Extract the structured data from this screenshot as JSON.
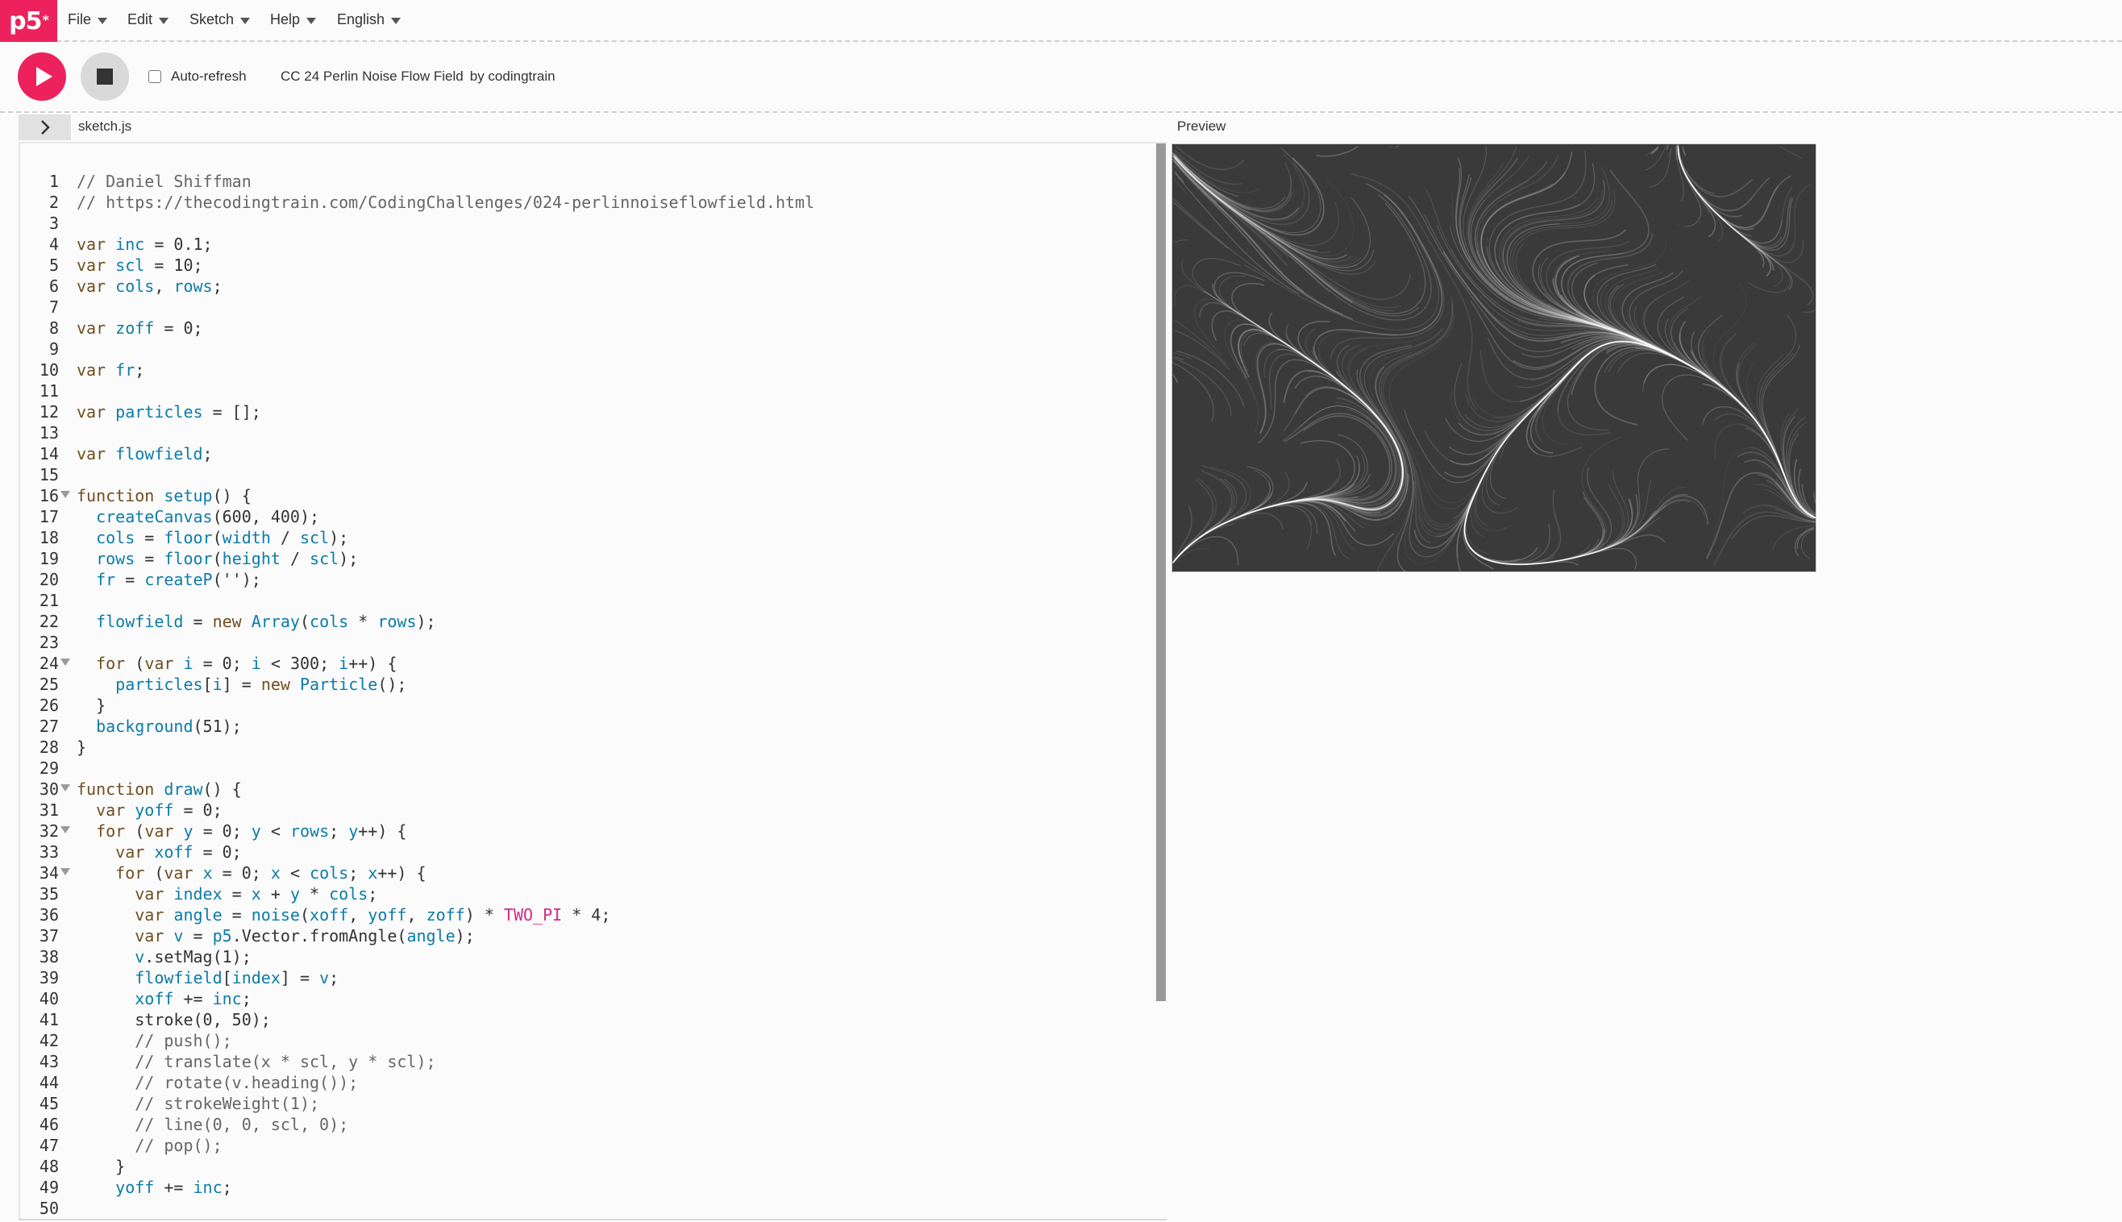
{
  "menubar": {
    "logo": "p5",
    "items": [
      {
        "label": "File"
      },
      {
        "label": "Edit"
      },
      {
        "label": "Sketch"
      },
      {
        "label": "Help"
      },
      {
        "label": "English"
      }
    ]
  },
  "toolbar": {
    "auto_refresh_label": "Auto-refresh",
    "auto_refresh_checked": false,
    "sketch_name": "CC 24 Perlin Noise Flow Field",
    "author": "by codingtrain"
  },
  "editor": {
    "file_name": "sketch.js",
    "folded_lines": [
      16,
      24,
      30,
      32,
      34
    ],
    "lines": [
      "// Daniel Shiffman",
      "// https://thecodingtrain.com/CodingChallenges/024-perlinnoiseflowfield.html",
      "",
      "var inc = 0.1;",
      "var scl = 10;",
      "var cols, rows;",
      "",
      "var zoff = 0;",
      "",
      "var fr;",
      "",
      "var particles = [];",
      "",
      "var flowfield;",
      "",
      "function setup() {",
      "  createCanvas(600, 400);",
      "  cols = floor(width / scl);",
      "  rows = floor(height / scl);",
      "  fr = createP('');",
      "",
      "  flowfield = new Array(cols * rows);",
      "",
      "  for (var i = 0; i < 300; i++) {",
      "    particles[i] = new Particle();",
      "  }",
      "  background(51);",
      "}",
      "",
      "function draw() {",
      "  var yoff = 0;",
      "  for (var y = 0; y < rows; y++) {",
      "    var xoff = 0;",
      "    for (var x = 0; x < cols; x++) {",
      "      var index = x + y * cols;",
      "      var angle = noise(xoff, yoff, zoff) * TWO_PI * 4;",
      "      var v = p5.Vector.fromAngle(angle);",
      "      v.setMag(1);",
      "      flowfield[index] = v;",
      "      xoff += inc;",
      "      stroke(0, 50);",
      "      // push();",
      "      // translate(x * scl, y * scl);",
      "      // rotate(v.heading());",
      "      // strokeWeight(1);",
      "      // line(0, 0, scl, 0);",
      "      // pop();",
      "    }",
      "    yoff += inc;",
      ""
    ]
  },
  "preview": {
    "label": "Preview"
  },
  "colors": {
    "accent": "#ed225d",
    "keyword": "#704f21",
    "identifier": "#0b7ca9",
    "constant": "#d52889"
  }
}
